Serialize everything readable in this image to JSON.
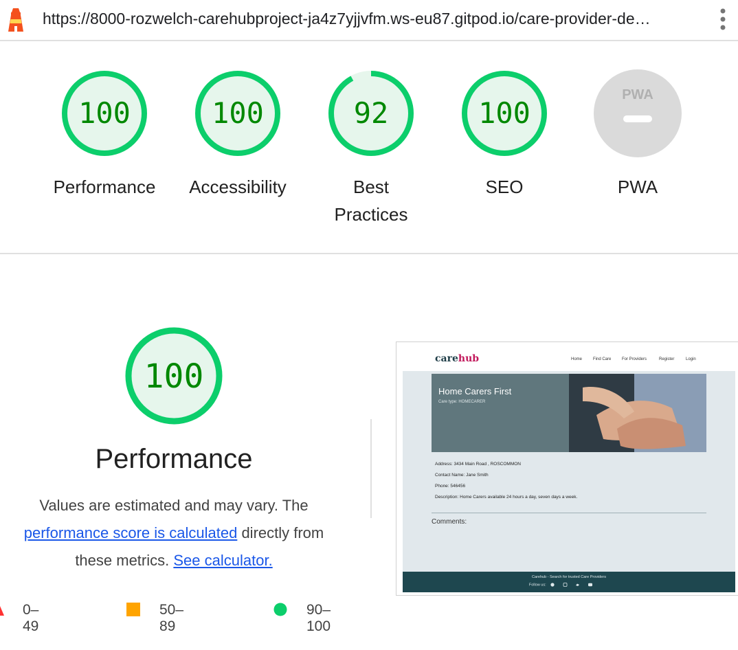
{
  "browser": {
    "url": "https://8000-rozwelch-carehubproject-ja4z7yjjvfm.ws-eu87.gitpod.io/care-provider-de…"
  },
  "gauges": [
    {
      "label": "Performance",
      "score": "100",
      "value": 100
    },
    {
      "label": "Accessibility",
      "score": "100",
      "value": 100
    },
    {
      "label_line1": "Best",
      "label_line2": "Practices",
      "score": "92",
      "value": 92
    },
    {
      "label": "SEO",
      "score": "100",
      "value": 100
    },
    {
      "label": "PWA",
      "badge": "PWA"
    }
  ],
  "performance": {
    "score": "100",
    "title": "Performance",
    "desc_part1": "Values are estimated and may vary. The",
    "desc_link1": "performance score is calculated",
    "desc_part2": " directly from",
    "desc_part3": "these metrics.",
    "desc_link2": "See calculator."
  },
  "legend": [
    {
      "range": "0–49",
      "color": "#ff3333"
    },
    {
      "range": "50–89",
      "color": "#ffa400"
    },
    {
      "range": "90–100",
      "color": "#0cce6b"
    }
  ],
  "colors": {
    "pass": "#0cce6b",
    "pass_text": "#008800",
    "pass_fill": "#e6f6ec",
    "pwa_gray": "#dadada"
  },
  "screenshot": {
    "logo_a": "care",
    "logo_b": "hub",
    "nav": [
      "Home",
      "Find Care",
      "For Providers",
      "Register",
      "Login"
    ],
    "hero_title": "Home Carers First",
    "hero_subtitle": "Care type: HOMECARER",
    "details": [
      "Address: 3434 Main Road , ROSCOMMON",
      "Contact Name: Jane Smith",
      "Phone: 546456",
      "Description: Home Carers available 24 hours a day, seven days a week."
    ],
    "comments": "Comments:",
    "footer_text": "Carehub - Search for trusted Care Providers",
    "follow_label": "Follow us:"
  }
}
